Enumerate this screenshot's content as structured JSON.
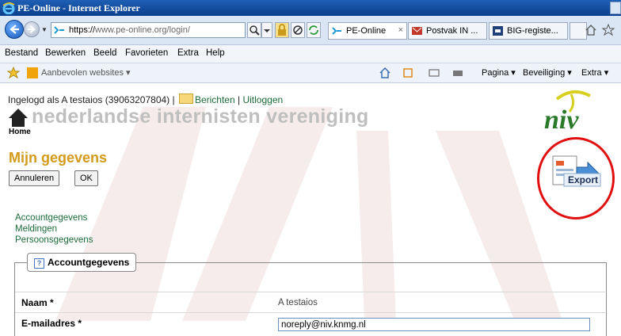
{
  "window": {
    "title": "PE-Online - Internet Explorer"
  },
  "addressbar": {
    "url_prefix": "https://",
    "url_domain": "www.pe-online.org",
    "url_path": "/login/"
  },
  "tabs": [
    {
      "label": "PE-Online",
      "close": "×"
    },
    {
      "label": "Postvak IN ...",
      "close": ""
    },
    {
      "label": "BIG-registe...",
      "close": ""
    }
  ],
  "menubar": [
    "Bestand",
    "Bewerken",
    "Beeld",
    "Favorieten",
    "Extra",
    "Help"
  ],
  "favbar": {
    "recommended": "Aanbevolen websites ▾",
    "commands": [
      "Pagina ▾",
      "Beveiliging ▾",
      "Extra ▾"
    ]
  },
  "page": {
    "login_prefix": "Ingelogd als A testaios (39063207804) |",
    "messages_link": "Berichten",
    "separator": "|",
    "logout_link": "Uitloggen",
    "home_label": "Home",
    "org_name": "nederlandse internisten vereniging",
    "logo_text": "niv",
    "section_title": "Mijn gegevens",
    "cancel_button": "Annuleren",
    "ok_button": "OK",
    "export_label": "Export",
    "links": [
      "Accountgegevens",
      "Meldingen",
      "Persoonsgegevens"
    ],
    "fieldset_legend": "Accountgegevens",
    "help_icon": "?",
    "fields": {
      "name_label": "Naam *",
      "name_value": "A testaios",
      "email_label": "E-mailadres *",
      "email_value": "noreply@niv.knmg.nl"
    }
  },
  "colors": {
    "titlebar": "#0b3f8c",
    "section_title": "#d49a1a",
    "link": "#1b6b3a",
    "annotation": "#e01010"
  }
}
